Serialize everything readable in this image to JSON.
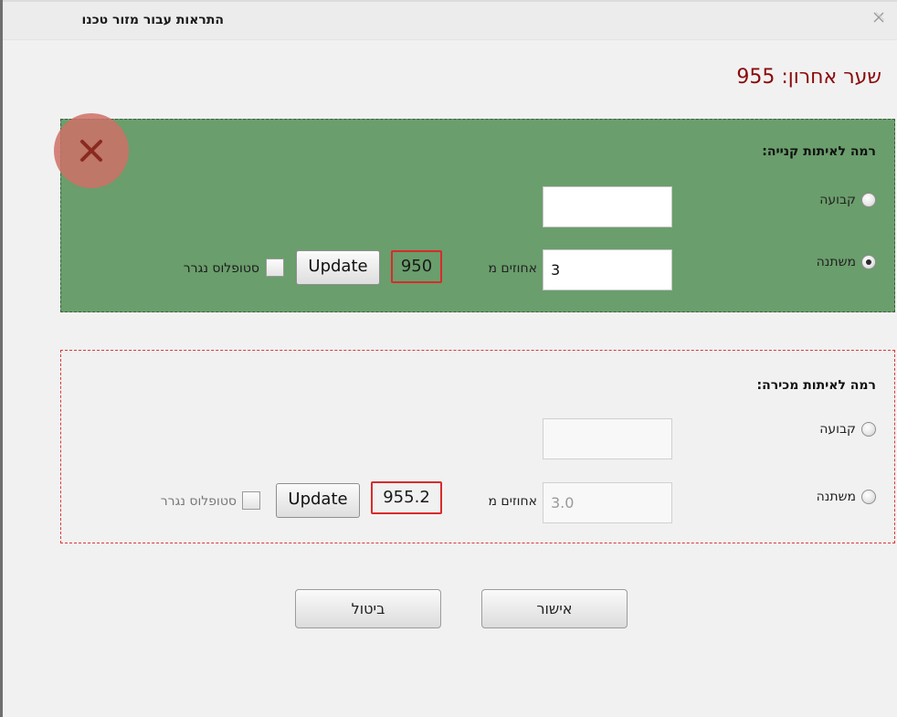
{
  "window": {
    "title": "התראות עבור מזור טכנו",
    "close_icon": "close-icon"
  },
  "last_price": "שער אחרון: 955",
  "delete_icon": "delete-x-icon",
  "buy": {
    "title": "רמה לאיתות קנייה:",
    "fixed_label": "קבועה",
    "fixed_value": "",
    "variable_label": "משתנה",
    "variable_value": "3",
    "selected": "variable",
    "percent_label": "אחוזים מ",
    "reference_value": "950",
    "update_label": "Update",
    "trailing_stop_label": "סטופלוס נגרר",
    "trailing_stop_checked": false,
    "background_color": "#6a9e6c"
  },
  "sell": {
    "title": "רמה לאיתות מכירה:",
    "fixed_label": "קבועה",
    "fixed_value": "",
    "variable_label": "משתנה",
    "variable_value": "3.0",
    "selected": "none",
    "percent_label": "אחוזים מ",
    "reference_value": "955.2",
    "update_label": "Update",
    "trailing_stop_label": "סטופלוס נגרר",
    "trailing_stop_checked": false,
    "border_color": "#d73a3a"
  },
  "footer": {
    "ok_label": "אישור",
    "cancel_label": "ביטול"
  }
}
